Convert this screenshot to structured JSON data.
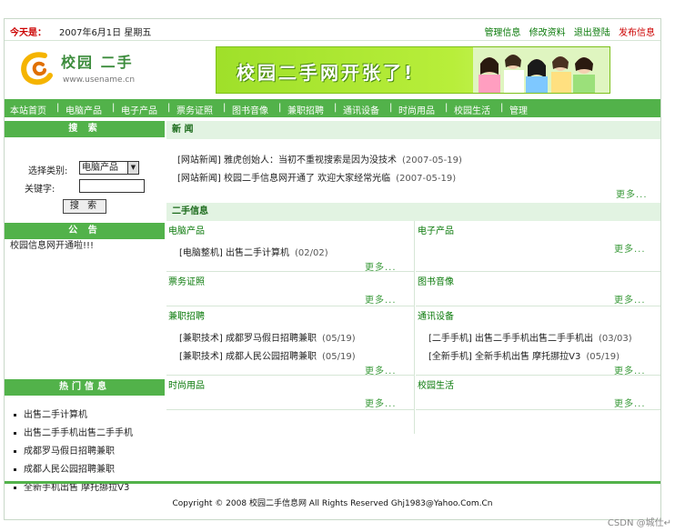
{
  "topbar": {
    "today_label": "今天是：",
    "today_value": "2007年6月1日 星期五",
    "links": [
      "管理信息",
      "修改资料",
      "退出登陆",
      "发布信息"
    ]
  },
  "header": {
    "logo_text": "校园 二手",
    "logo_sub": "www.usename.cn",
    "banner_text": "校园二手网开张了!"
  },
  "nav": {
    "items": [
      "本站首页",
      "电脑产品",
      "电子产品",
      "票务证照",
      "图书音像",
      "兼职招聘",
      "通讯设备",
      "时尚用品",
      "校园生活",
      "管理"
    ]
  },
  "search": {
    "title": "搜 索",
    "category_label": "选择类别:",
    "category_value": "电脑产品",
    "keyword_label": "关键字:",
    "keyword_value": "",
    "button": "搜 索"
  },
  "notice": {
    "title": "公 告",
    "text": "校园信息网开通啦!!!"
  },
  "hot": {
    "title": "热门信息",
    "items": [
      "出售二手计算机",
      "出售二手手机出售二手手机",
      "成都罗马假日招聘兼职",
      "成都人民公园招聘兼职",
      "全新手机出售 摩托挪拉V3"
    ]
  },
  "news": {
    "title": "新 闻",
    "items": [
      {
        "text": "[网站新闻] 雅虎创始人：当初不重视搜索是因为没技术",
        "date": "(2007-05-19)"
      },
      {
        "text": "[网站新闻] 校园二手信息网开通了 欢迎大家经常光临",
        "date": "(2007-05-19)"
      }
    ],
    "more": "更多..."
  },
  "secondhand": {
    "title": "二手信息",
    "more": "更多...",
    "cells": {
      "computer": {
        "title": "电脑产品",
        "items": [
          {
            "text": "[电脑整机] 出售二手计算机",
            "date": "(02/02)"
          }
        ]
      },
      "electronic": {
        "title": "电子产品",
        "items": []
      },
      "ticket": {
        "title": "票务证照",
        "items": []
      },
      "books": {
        "title": "图书音像",
        "items": []
      },
      "jobs": {
        "title": "兼职招聘",
        "items": [
          {
            "text": "[兼职技术] 成都罗马假日招聘兼职",
            "date": "(05/19)"
          },
          {
            "text": "[兼职技术] 成都人民公园招聘兼职",
            "date": "(05/19)"
          }
        ]
      },
      "comm": {
        "title": "通讯设备",
        "items": [
          {
            "text": "[二手手机] 出售二手手机出售二手手机出",
            "date": "(03/03)"
          },
          {
            "text": "[全新手机] 全新手机出售 摩托挪拉V3",
            "date": "(05/19)"
          }
        ]
      },
      "fashion": {
        "title": "时尚用品",
        "items": []
      },
      "campus": {
        "title": "校园生活",
        "items": []
      }
    }
  },
  "footer": {
    "text": "Copyright © 2008 校园二手信息网 All Rights Reserved Ghj1983@Yahoo.Com.Cn"
  },
  "watermark": "CSDN @城仕↵"
}
